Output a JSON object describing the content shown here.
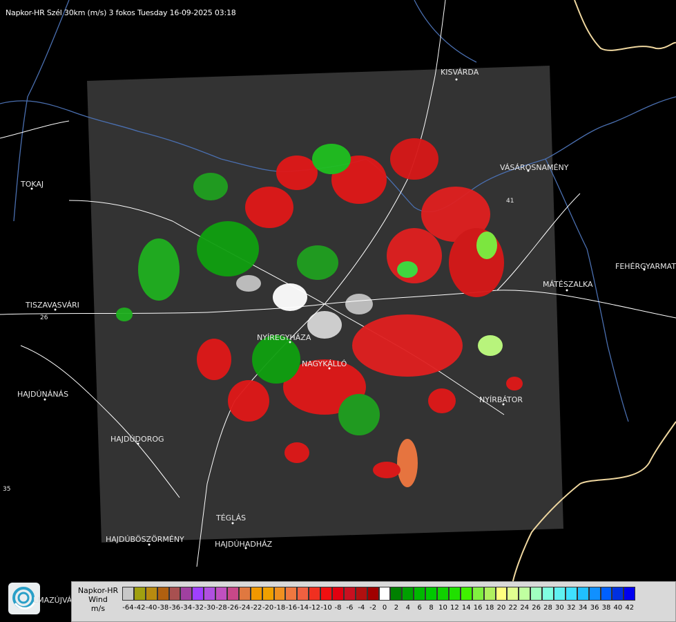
{
  "header": {
    "title": "Napkor-HR Szél 30km (m/s) 3 fokos Tuesday 16-09-2025 03:18"
  },
  "map": {
    "cities": [
      {
        "name": "KISVÁRDA"
      },
      {
        "name": "TOKAJ"
      },
      {
        "name": "VÁSÁROSNAMÉNY"
      },
      {
        "name": "FEHÉRGYARMAT"
      },
      {
        "name": "MÁTÉSZALKA"
      },
      {
        "name": "TISZAVASVÁRI"
      },
      {
        "name": "NYÍREGYHÁZA"
      },
      {
        "name": "NAGYKÁLLÓ"
      },
      {
        "name": "HAJDÚNÁNÁS"
      },
      {
        "name": "NYÍRBÁTOR"
      },
      {
        "name": "HAJDÚDOROG"
      },
      {
        "name": "TÉGLÁS"
      },
      {
        "name": "HAJDÚBÖSZÖRMÉNY"
      },
      {
        "name": "HAJDÚHADHÁZ"
      }
    ],
    "road_numbers": [
      "26",
      "35",
      "41"
    ],
    "colors": {
      "background": "#000000",
      "coverage": "#333333",
      "border_line": "#f0d8a0",
      "river": "#4a6fb0",
      "road": "#ffffff"
    }
  },
  "footer": {
    "partial_label": "LMAZÚJVÁR"
  },
  "legend": {
    "title_lines": [
      "Napkor-HR",
      "Wind",
      "m/s"
    ],
    "ticks": [
      "-64",
      "-42",
      "-40",
      "-38",
      "-36",
      "-34",
      "-32",
      "-30",
      "-28",
      "-26",
      "-24",
      "-22",
      "-20",
      "-18",
      "-16",
      "-14",
      "-12",
      "-10",
      "-8",
      "-6",
      "-4",
      "-2",
      "0",
      "2",
      "4",
      "6",
      "8",
      "10",
      "12",
      "14",
      "16",
      "18",
      "20",
      "22",
      "24",
      "26",
      "28",
      "30",
      "32",
      "34",
      "36",
      "38",
      "40",
      "42"
    ],
    "colors": [
      "#c8c8c8",
      "#a0a010",
      "#b88a10",
      "#b06010",
      "#a85050",
      "#a040a0",
      "#a040ff",
      "#b050e0",
      "#c050c0",
      "#c84888",
      "#e07840",
      "#f09800",
      "#f0a000",
      "#f09020",
      "#f07840",
      "#f06040",
      "#f03020",
      "#f01010",
      "#e00010",
      "#c81020",
      "#b01010",
      "#a00000",
      "#ffffff",
      "#008000",
      "#00a000",
      "#00b800",
      "#00c800",
      "#10d000",
      "#20e000",
      "#40f000",
      "#80f040",
      "#b0f060",
      "#ffff80",
      "#e0ff90",
      "#c0ffa0",
      "#a0ffc0",
      "#80ffe0",
      "#60f0f0",
      "#40e0ff",
      "#20c0ff",
      "#1090ff",
      "#0060ff",
      "#0030e0",
      "#0000f0"
    ]
  }
}
